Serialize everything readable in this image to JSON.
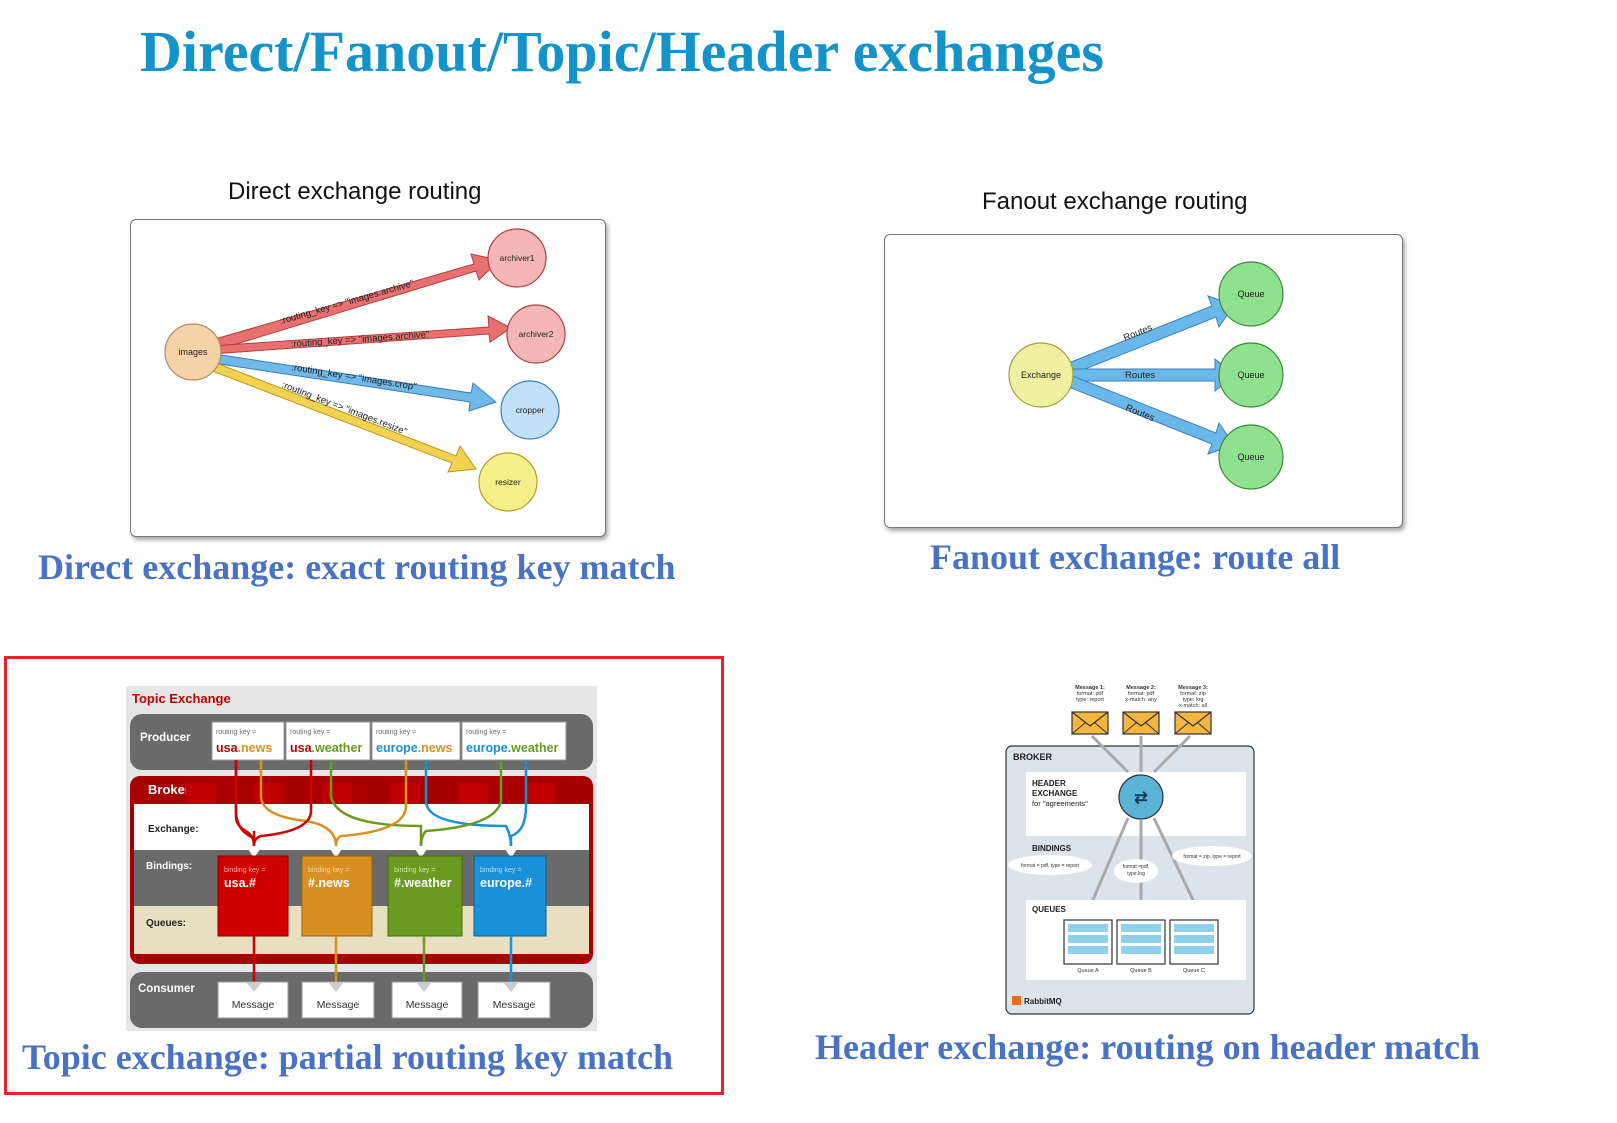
{
  "slide": {
    "title": "Direct/Fanout/Topic/Header exchanges"
  },
  "direct": {
    "title": "Direct exchange routing",
    "caption": "Direct exchange: exact routing key match",
    "source": "images",
    "targets": [
      "archiver1",
      "archiver2",
      "cropper",
      "resizer"
    ],
    "keys": [
      ":routing_key => \"images.archive\"",
      ":routing_key => \"images.archive\"",
      ":routing_key => \"images.crop\"",
      ":routing_key => \"images.resize\""
    ],
    "colors": {
      "red": "#e87070",
      "blue": "#70b8e8",
      "yellow": "#f2d250",
      "source": "#f5d2a8"
    }
  },
  "fanout": {
    "title": "Fanout exchange routing",
    "caption": "Fanout exchange: route all",
    "source": "Exchange",
    "queues": [
      "Queue",
      "Queue",
      "Queue"
    ],
    "labels": [
      "Routes",
      "Routes",
      "Routes"
    ],
    "colors": {
      "green": "#8fe08f",
      "source": "#f0f0a0",
      "arrow": "#6ab8ea"
    }
  },
  "topic": {
    "title": "Topic Exchange",
    "caption": "Topic exchange: partial routing key match",
    "producer_label": "Producer",
    "broker_label": "Broker",
    "exchange_label": "Exchange:",
    "bindings_label": "Bindings:",
    "queues_label": "Queues:",
    "consumer_label": "Consumer",
    "routing_key_prefix": "routing key =",
    "binding_key_prefix": "binding key =",
    "routing_keys": [
      {
        "a": "usa",
        "b": ".news"
      },
      {
        "a": "usa",
        "b": ".weather"
      },
      {
        "a": "europe",
        "b": ".news"
      },
      {
        "a": "europe",
        "b": ".weather"
      }
    ],
    "binding_keys": [
      "usa.#",
      "#.news",
      "#.weather",
      "europe.#"
    ],
    "message_label": "Message",
    "colors": {
      "red": "#d00000",
      "orange": "#d89020",
      "green": "#6a9a20",
      "blue": "#1a90d8"
    }
  },
  "header": {
    "caption": "Header exchange: routing on header match",
    "messages": [
      {
        "title": "Message 1:",
        "l1": "format: pdf",
        "l2": "type: report",
        "l3": ""
      },
      {
        "title": "Message 2:",
        "l1": "format: pdf",
        "l2": "x-match: any",
        "l3": ""
      },
      {
        "title": "Message 3:",
        "l1": "format: zip",
        "l2": "type: log",
        "l3": "x-match: all"
      }
    ],
    "broker_label": "BROKER",
    "exchange_l1": "HEADER",
    "exchange_l2": "EXCHANGE",
    "exchange_l3": "for \"agreements\"",
    "bindings_label": "BINDINGS",
    "binding_1": "format = pdf, type = report",
    "binding_2a": "format =pdf,",
    "binding_2b": "type.log",
    "binding_3": "format = zip, type = report",
    "queues_label": "QUEUES",
    "queue_names": [
      "Queue A",
      "Queue B",
      "Queue C"
    ],
    "brand": "RabbitMQ"
  }
}
